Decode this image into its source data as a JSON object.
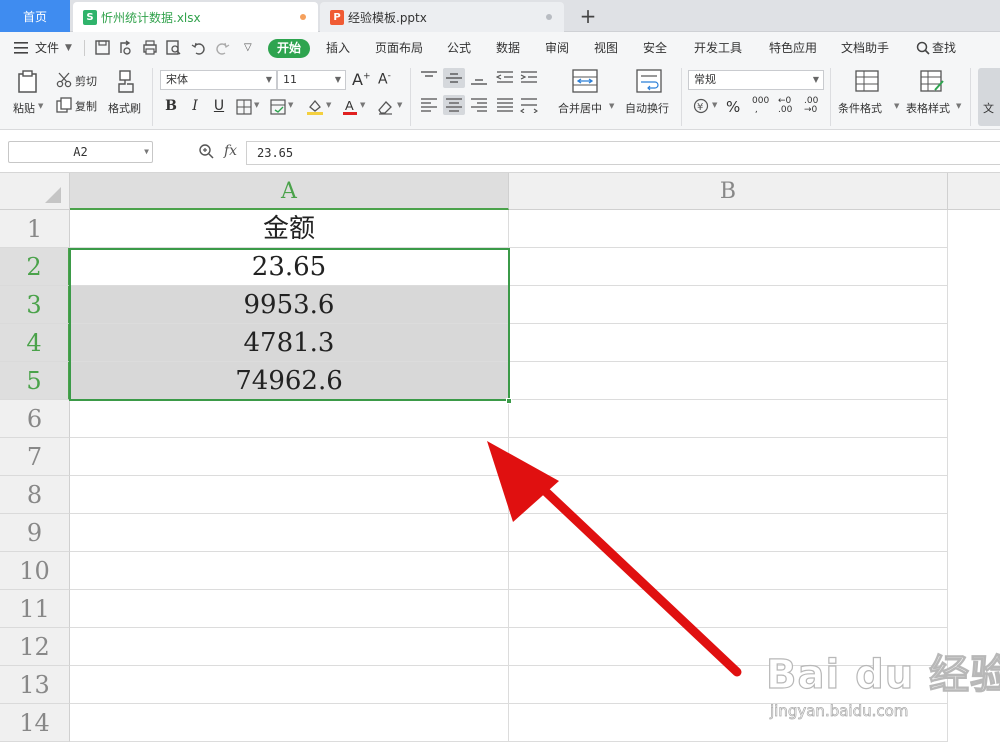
{
  "tabs": {
    "home": "首页",
    "active_file": "忻州统计数据.xlsx",
    "inactive_file": "经验模板.pptx",
    "new_tab": "+"
  },
  "menu": {
    "file": "文件",
    "start": "开始",
    "items": [
      "插入",
      "页面布局",
      "公式",
      "数据",
      "审阅",
      "视图",
      "安全",
      "开发工具",
      "特色应用",
      "文档助手"
    ],
    "search": "查找"
  },
  "ribbon": {
    "paste": "粘贴",
    "cut": "剪切",
    "copy": "复制",
    "format_painter": "格式刷",
    "font_name": "宋体",
    "font_size": "11",
    "merge_center": "合并居中",
    "wrap_text": "自动换行",
    "number_format": "常规",
    "conditional_format": "条件格式",
    "table_style": "表格样式",
    "doc_partial": "文"
  },
  "formula_bar": {
    "name_box": "A2",
    "fx": "fx",
    "value": "23.65"
  },
  "sheet": {
    "columns": [
      "A",
      "B"
    ],
    "rows": [
      "1",
      "2",
      "3",
      "4",
      "5",
      "6",
      "7",
      "8",
      "9",
      "10",
      "11",
      "12",
      "13",
      "14"
    ],
    "header_cell": "金额",
    "values": [
      "23.65",
      "9953.6",
      "4781.3",
      "74962.6"
    ]
  },
  "watermark": {
    "main": "Bai du 经验",
    "sub": "jingyan.baidu.com"
  },
  "colors": {
    "accent_green": "#2ea44f",
    "selection_green": "#3b9a48",
    "tab_blue": "#3f8cf0",
    "arrow_red": "#e01010"
  }
}
